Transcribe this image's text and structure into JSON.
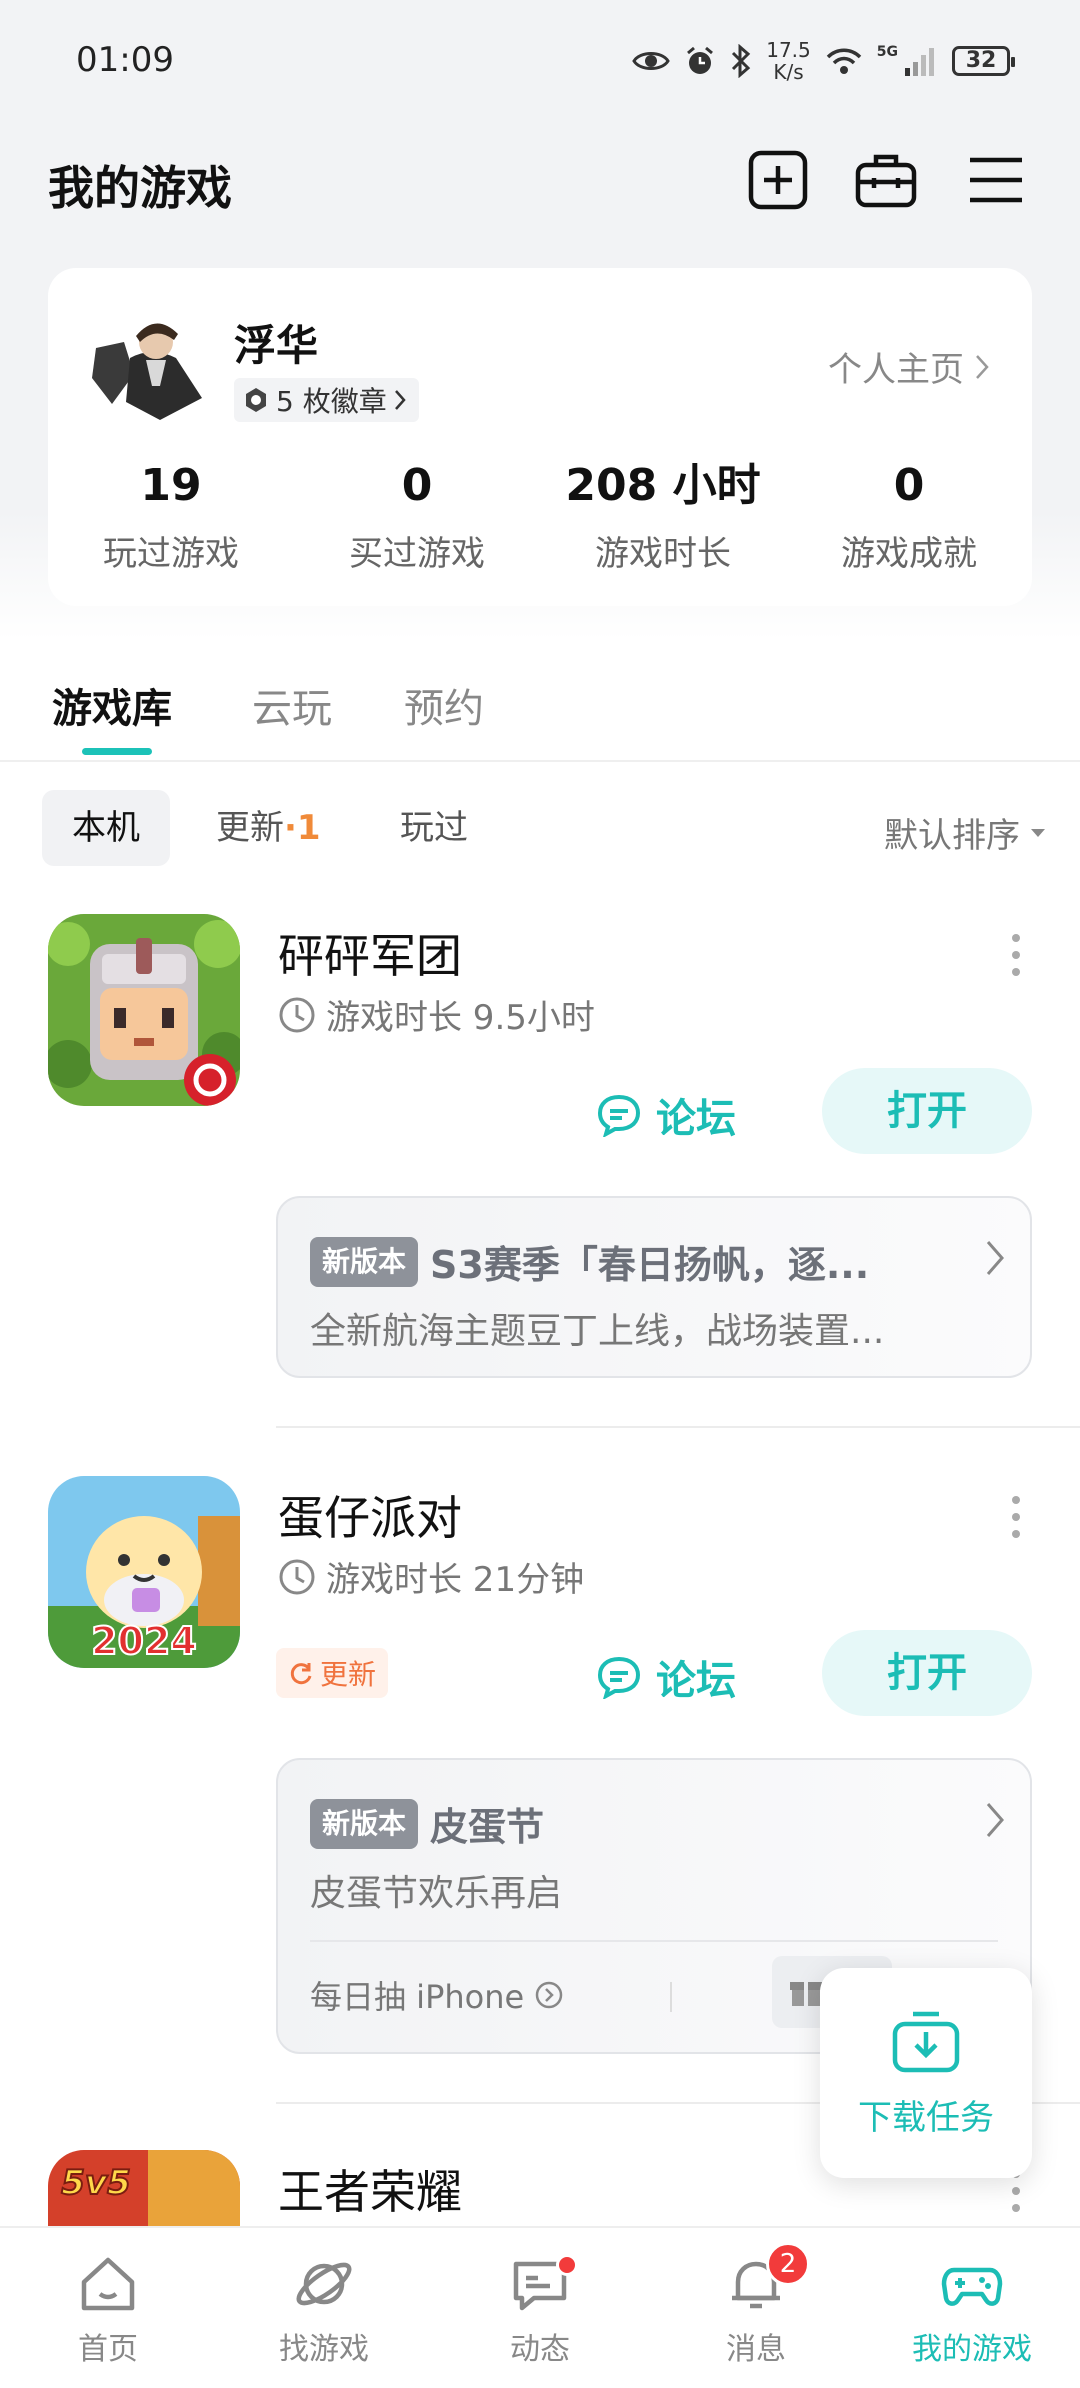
{
  "status_bar": {
    "time": "01:09",
    "speed_value": "17.5",
    "speed_unit": "K/s",
    "signal": "5G",
    "battery": "32"
  },
  "header": {
    "title": "我的游戏",
    "icons": [
      "add-square-icon",
      "toolbox-icon",
      "menu-icon"
    ]
  },
  "profile": {
    "nickname": "浮华",
    "badges": "5 枚徽章",
    "home_link": "个人主页",
    "stats": [
      {
        "value": "19",
        "label": "玩过游戏"
      },
      {
        "value": "0",
        "label": "买过游戏"
      },
      {
        "value": "208 小时",
        "label": "游戏时长"
      },
      {
        "value": "0",
        "label": "游戏成就"
      }
    ]
  },
  "tabs": [
    {
      "label": "游戏库",
      "active": true
    },
    {
      "label": "云玩",
      "active": false
    },
    {
      "label": "预约",
      "active": false
    }
  ],
  "filters": {
    "local": "本机",
    "update": "更新",
    "update_count": "·1",
    "played": "玩过",
    "sort": "默认排序"
  },
  "games": [
    {
      "name": "砰砰军团",
      "playtime": "游戏时长 9.5小时",
      "forum": "论坛",
      "open": "打开",
      "news": {
        "tag": "新版本",
        "title": "S3赛季「春日扬帆，逐...",
        "subtitle": "全新航海主题豆丁上线，战场装置..."
      }
    },
    {
      "name": "蛋仔派对",
      "playtime": "游戏时长 21分钟",
      "update_tag": "更新",
      "icon_text": "2024",
      "forum": "论坛",
      "open": "打开",
      "news": {
        "tag": "新版本",
        "title": "皮蛋节",
        "subtitle": "皮蛋节欢乐再启",
        "extra": "每日抽 iPhone"
      }
    },
    {
      "name": "王者荣耀",
      "icon_text": "5v5"
    }
  ],
  "download_fab": {
    "label": "下载任务"
  },
  "bottom_nav": [
    {
      "label": "首页",
      "icon": "home-icon"
    },
    {
      "label": "找游戏",
      "icon": "planet-icon"
    },
    {
      "label": "动态",
      "icon": "chat-icon"
    },
    {
      "label": "消息",
      "icon": "bell-icon",
      "badge": "2"
    },
    {
      "label": "我的游戏",
      "icon": "gamepad-icon",
      "active": true
    }
  ],
  "colors": {
    "accent": "#1cbdb5",
    "update_orange": "#f08a39",
    "badge_red": "#f23b3b"
  }
}
